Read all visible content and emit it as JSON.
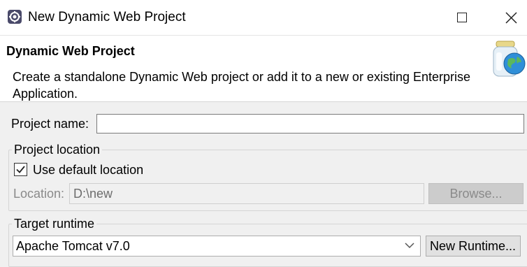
{
  "window": {
    "title": "New Dynamic Web Project",
    "icon": "eclipse-gear-icon"
  },
  "header": {
    "title": "Dynamic Web Project",
    "description": "Create a standalone Dynamic Web project or add it to a new or existing Enterprise Application.",
    "icon": "web-jar-globe-icon"
  },
  "form": {
    "project_name_label": "Project name:",
    "project_name_value": "",
    "location_group": {
      "title": "Project location",
      "use_default_label": "Use default location",
      "use_default_checked": true,
      "location_label": "Location:",
      "location_value": "D:\\new",
      "browse_label": "Browse..."
    },
    "runtime_group": {
      "title": "Target runtime",
      "selected": "Apache Tomcat v7.0",
      "new_runtime_label": "New Runtime..."
    }
  },
  "colors": {
    "background": "#f0f0f0",
    "disabled_text": "#8a8a8a"
  }
}
